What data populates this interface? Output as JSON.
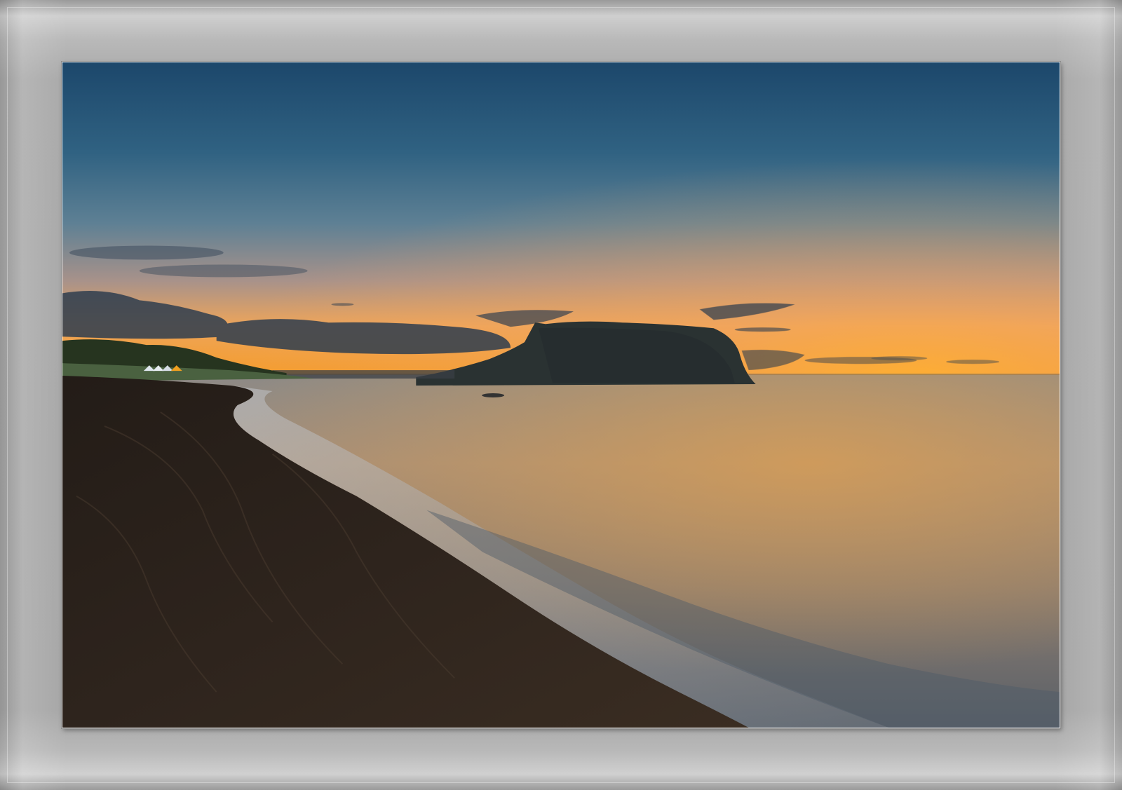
{
  "scene": {
    "subject": "coastal-sunset",
    "elements": [
      "sky",
      "clouds",
      "sea",
      "headland",
      "beach",
      "shoreline-surf",
      "grassy-hill",
      "tents"
    ]
  },
  "colors": {
    "sky_top": "#1d4a6e",
    "sky_mid": "#4f7b94",
    "sky_glow": "#f39a28",
    "horizon": "#f0a030",
    "sea_light": "#b79570",
    "sea_dark": "#4b5563",
    "sand": "#2b211b",
    "headland": "#2c3333",
    "frame": "#a8a8a8"
  }
}
